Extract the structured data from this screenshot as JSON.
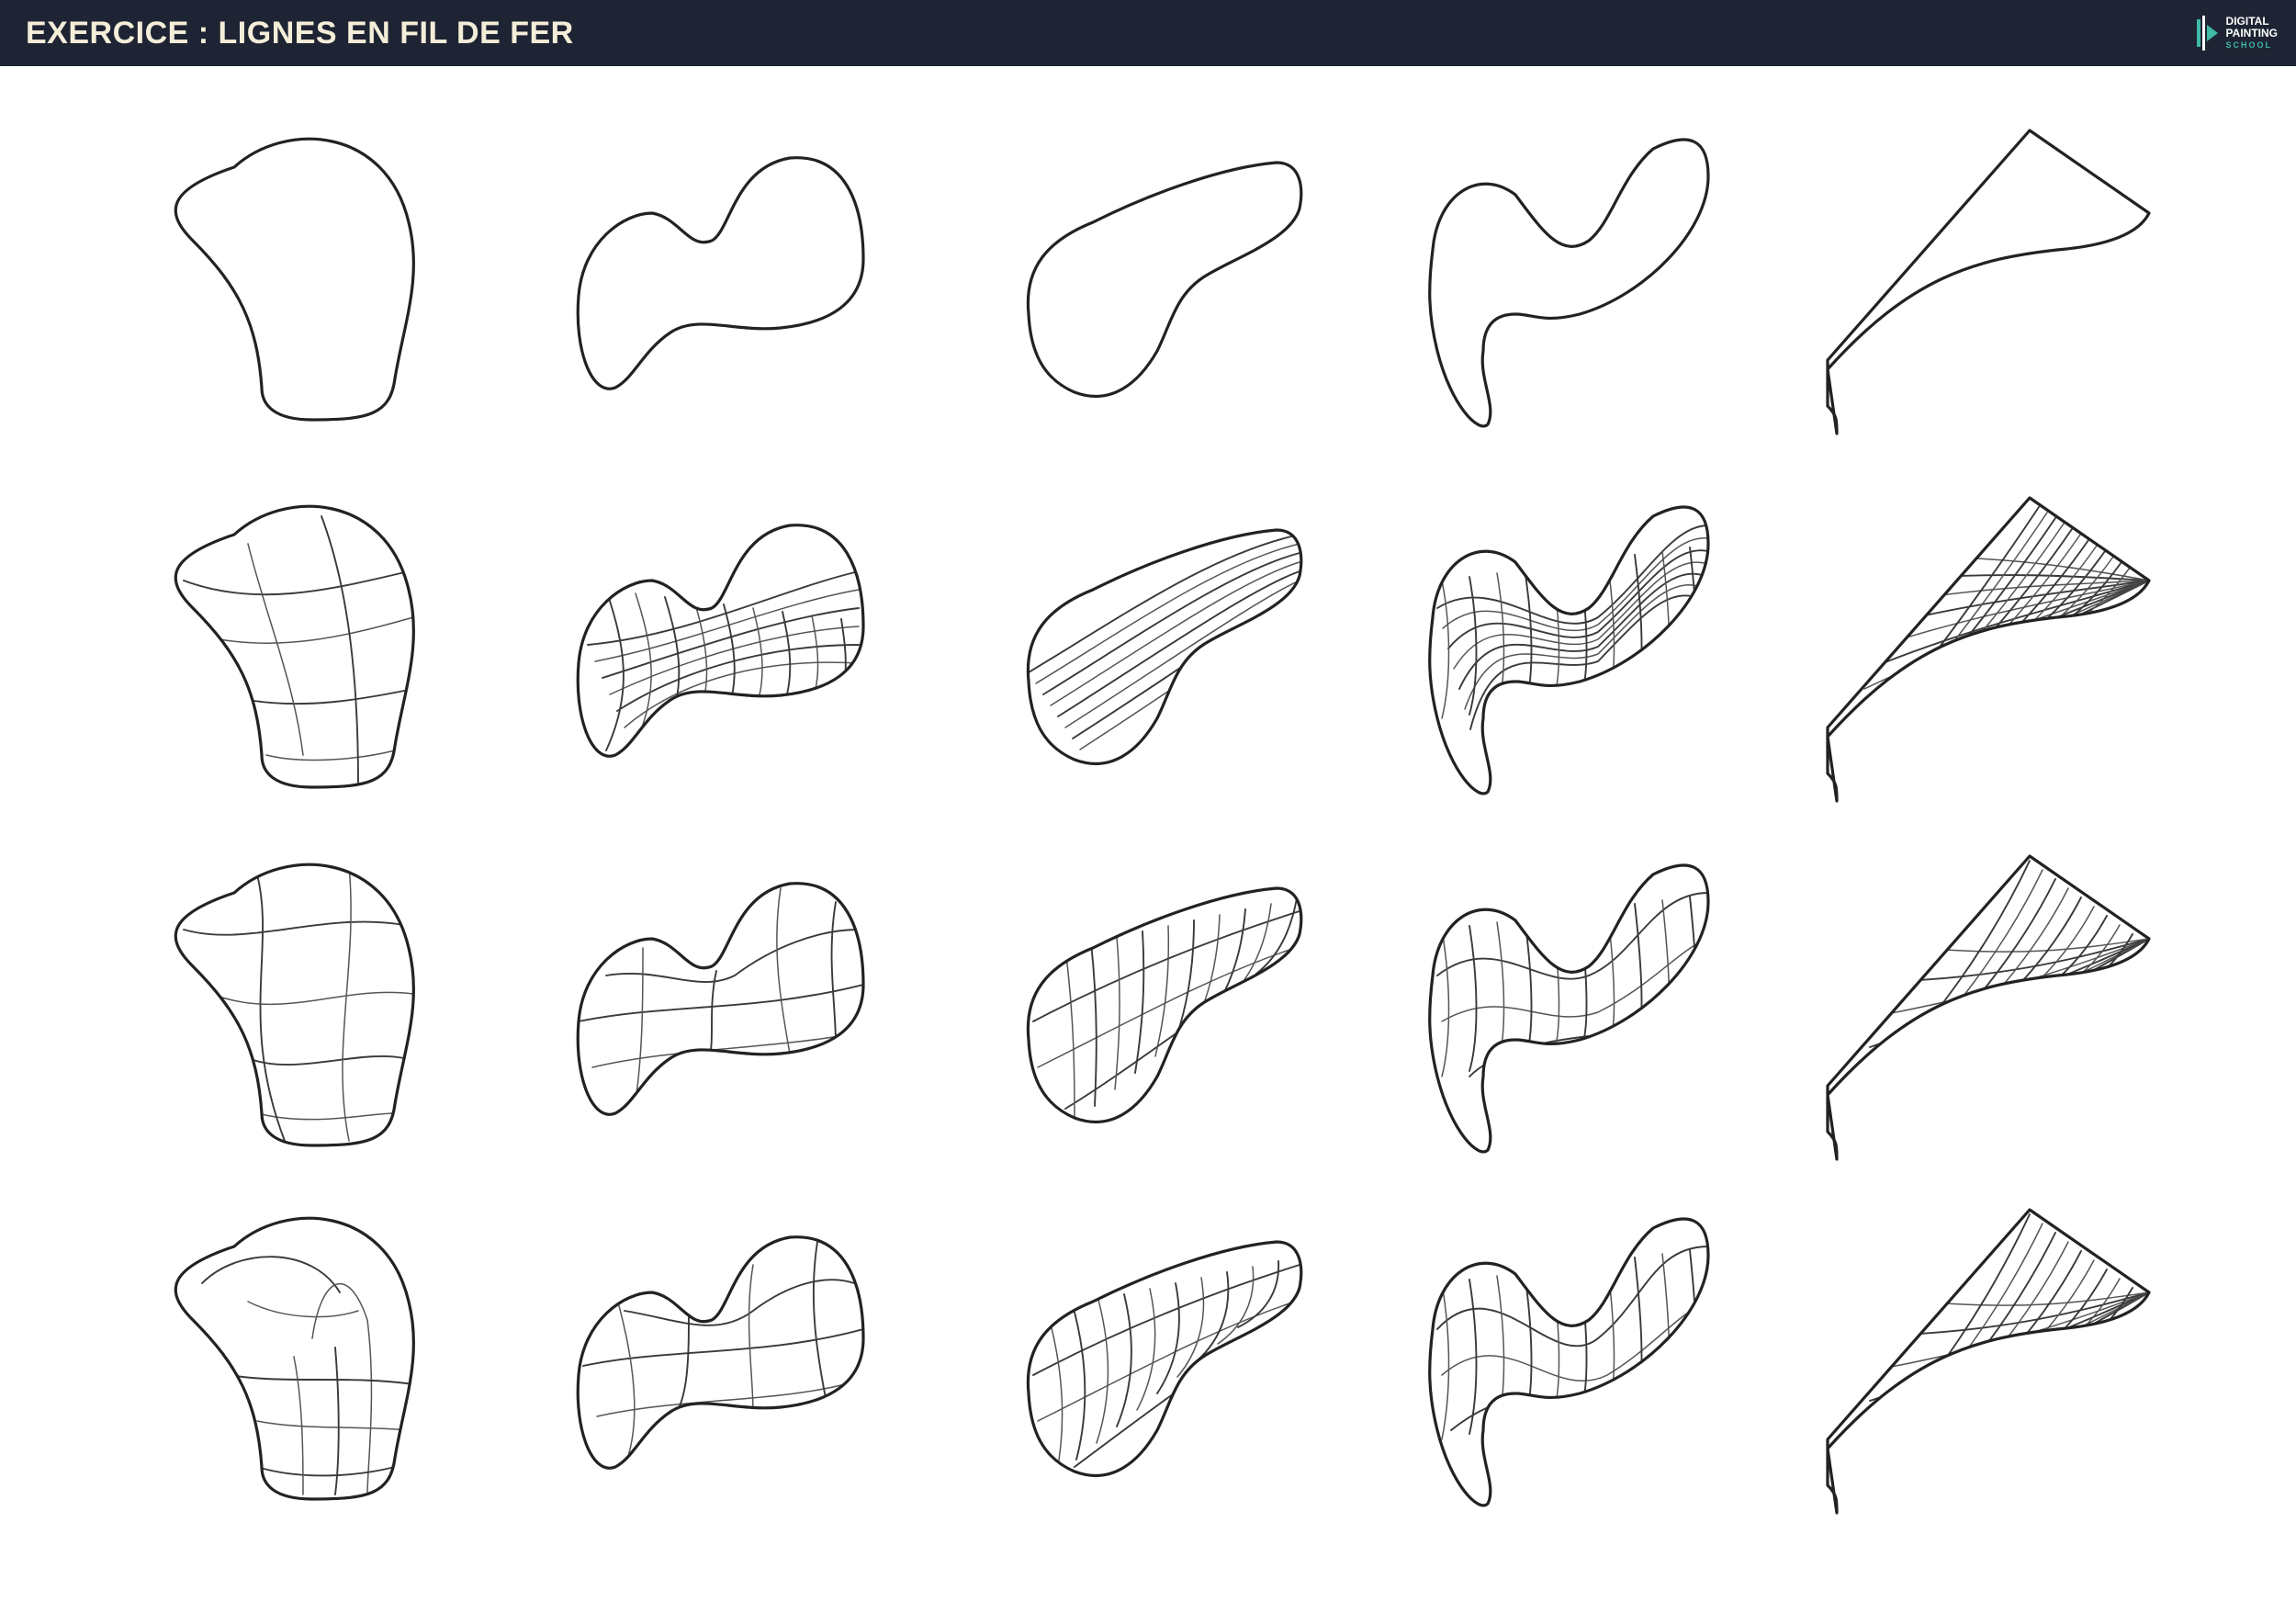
{
  "header": {
    "title": "EXERCICE : LIGNES EN FIL DE FER",
    "logo": {
      "line1": "DIGITAL",
      "line2": "PAINTING",
      "line3": "SCHOOL",
      "icon": "paint-brush-play-logo-icon"
    }
  },
  "colors": {
    "header_bg": "#1e2433",
    "title_text": "#f4eed9",
    "logo_accent": "#3fb9a8",
    "stroke": "#222222"
  },
  "grid": {
    "rows": [
      "outline-only",
      "wireframe-a",
      "wireframe-b",
      "wireframe-c"
    ],
    "columns": [
      "blob-shape",
      "peanut-shape",
      "bean-shape",
      "s-shape",
      "wedge-shape"
    ]
  }
}
